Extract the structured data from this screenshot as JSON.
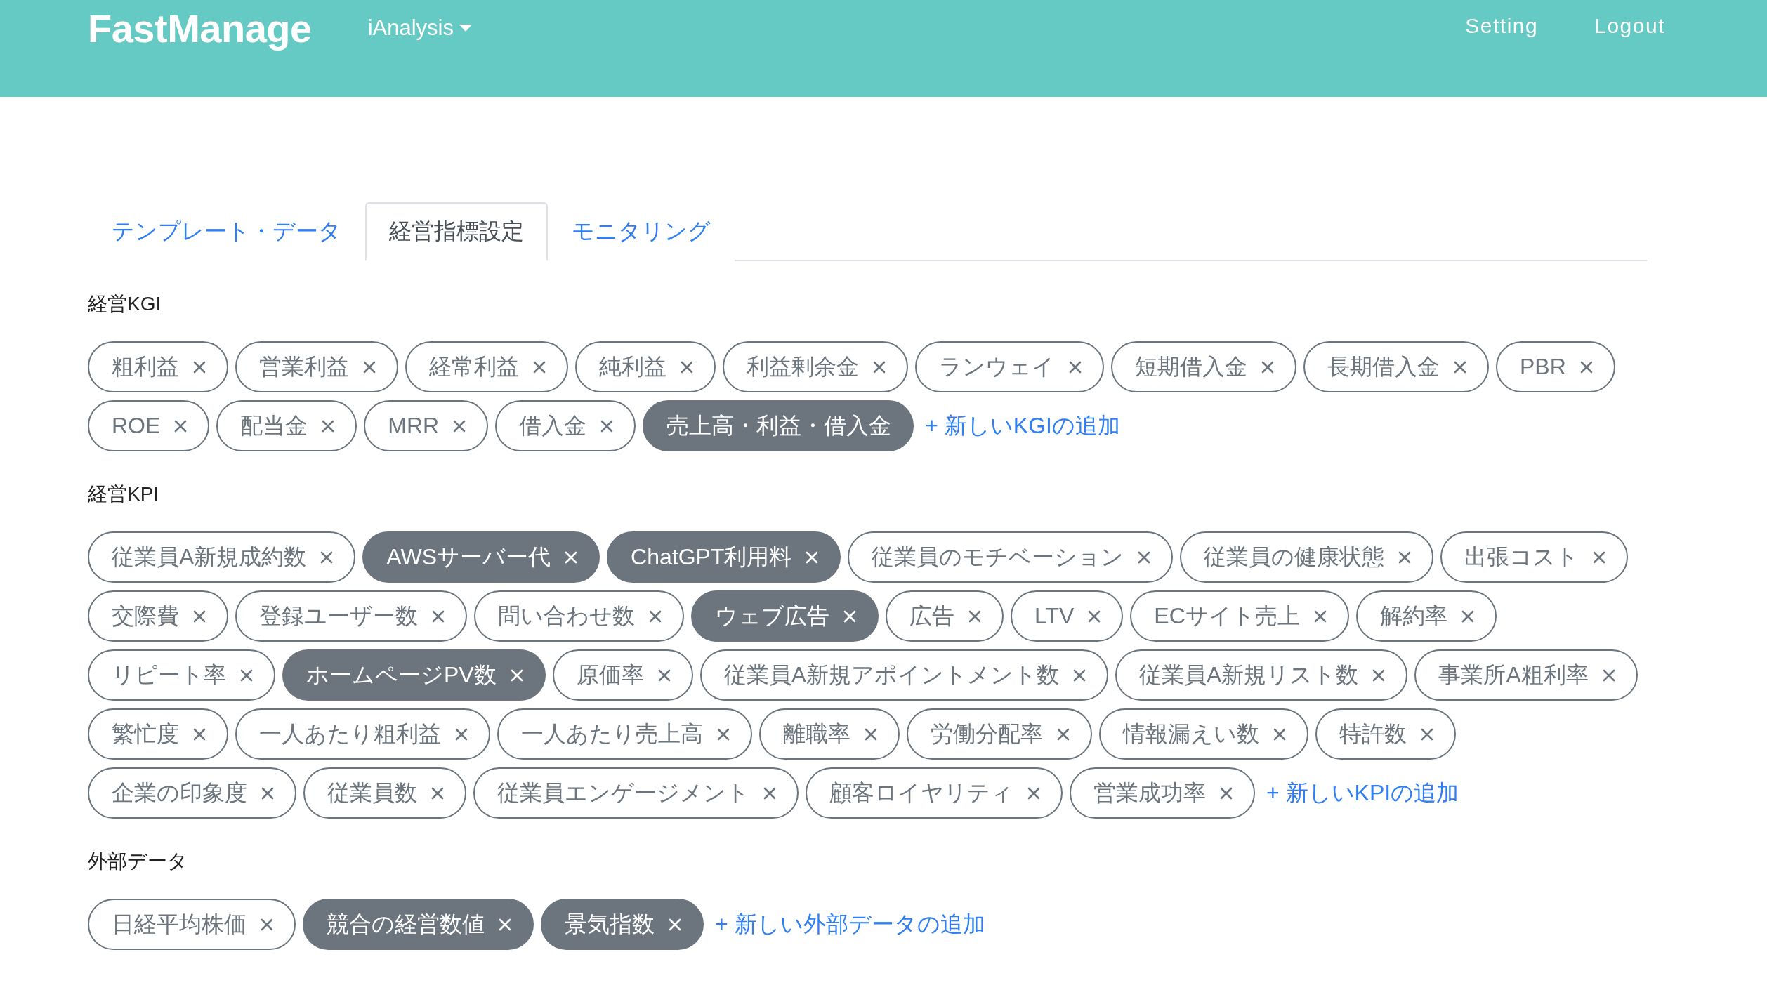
{
  "header": {
    "brand": "FastManage",
    "nav": {
      "label": "iAnalysis"
    },
    "links": [
      "Setting",
      "Logout"
    ]
  },
  "tabs": [
    {
      "label": "テンプレート・データ",
      "selected": false
    },
    {
      "label": "経営指標設定",
      "selected": true
    },
    {
      "label": "モニタリング",
      "selected": false
    }
  ],
  "sections": [
    {
      "title": "経営KGI",
      "add_link": "+ 新しいKGIの追加",
      "chips": [
        {
          "label": "粗利益",
          "selected": false,
          "removable": true
        },
        {
          "label": "営業利益",
          "selected": false,
          "removable": true
        },
        {
          "label": "経常利益",
          "selected": false,
          "removable": true
        },
        {
          "label": "純利益",
          "selected": false,
          "removable": true
        },
        {
          "label": "利益剰余金",
          "selected": false,
          "removable": true
        },
        {
          "label": "ランウェイ",
          "selected": false,
          "removable": true
        },
        {
          "label": "短期借入金",
          "selected": false,
          "removable": true
        },
        {
          "label": "長期借入金",
          "selected": false,
          "removable": true
        },
        {
          "label": "PBR",
          "selected": false,
          "removable": true
        },
        {
          "label": "ROE",
          "selected": false,
          "removable": true
        },
        {
          "label": "配当金",
          "selected": false,
          "removable": true
        },
        {
          "label": "MRR",
          "selected": false,
          "removable": true
        },
        {
          "label": "借入金",
          "selected": false,
          "removable": true
        },
        {
          "label": "売上高・利益・借入金",
          "selected": true,
          "removable": false
        }
      ]
    },
    {
      "title": "経営KPI",
      "add_link": "+ 新しいKPIの追加",
      "chips": [
        {
          "label": "従業員A新規成約数",
          "selected": false,
          "removable": true
        },
        {
          "label": "AWSサーバー代",
          "selected": true,
          "removable": true
        },
        {
          "label": "ChatGPT利用料",
          "selected": true,
          "removable": true
        },
        {
          "label": "従業員のモチベーション",
          "selected": false,
          "removable": true
        },
        {
          "label": "従業員の健康状態",
          "selected": false,
          "removable": true
        },
        {
          "label": "出張コスト",
          "selected": false,
          "removable": true
        },
        {
          "label": "交際費",
          "selected": false,
          "removable": true
        },
        {
          "label": "登録ユーザー数",
          "selected": false,
          "removable": true
        },
        {
          "label": "問い合わせ数",
          "selected": false,
          "removable": true
        },
        {
          "label": "ウェブ広告",
          "selected": true,
          "removable": true
        },
        {
          "label": "広告",
          "selected": false,
          "removable": true
        },
        {
          "label": "LTV",
          "selected": false,
          "removable": true
        },
        {
          "label": "ECサイト売上",
          "selected": false,
          "removable": true
        },
        {
          "label": "解約率",
          "selected": false,
          "removable": true
        },
        {
          "label": "リピート率",
          "selected": false,
          "removable": true
        },
        {
          "label": "ホームページPV数",
          "selected": true,
          "removable": true
        },
        {
          "label": "原価率",
          "selected": false,
          "removable": true
        },
        {
          "label": "従業員A新規アポイントメント数",
          "selected": false,
          "removable": true
        },
        {
          "label": "従業員A新規リスト数",
          "selected": false,
          "removable": true
        },
        {
          "label": "事業所A粗利率",
          "selected": false,
          "removable": true
        },
        {
          "label": "繁忙度",
          "selected": false,
          "removable": true
        },
        {
          "label": "一人あたり粗利益",
          "selected": false,
          "removable": true
        },
        {
          "label": "一人あたり売上高",
          "selected": false,
          "removable": true
        },
        {
          "label": "離職率",
          "selected": false,
          "removable": true
        },
        {
          "label": "労働分配率",
          "selected": false,
          "removable": true
        },
        {
          "label": "情報漏えい数",
          "selected": false,
          "removable": true
        },
        {
          "label": "特許数",
          "selected": false,
          "removable": true
        },
        {
          "label": "企業の印象度",
          "selected": false,
          "removable": true
        },
        {
          "label": "従業員数",
          "selected": false,
          "removable": true
        },
        {
          "label": "従業員エンゲージメント",
          "selected": false,
          "removable": true
        },
        {
          "label": "顧客ロイヤリティ",
          "selected": false,
          "removable": true
        },
        {
          "label": "営業成功率",
          "selected": false,
          "removable": true
        }
      ]
    },
    {
      "title": "外部データ",
      "add_link": "+ 新しい外部データの追加",
      "chips": [
        {
          "label": "日経平均株価",
          "selected": false,
          "removable": true
        },
        {
          "label": "競合の経営数値",
          "selected": true,
          "removable": true
        },
        {
          "label": "景気指数",
          "selected": true,
          "removable": true
        }
      ]
    }
  ]
}
